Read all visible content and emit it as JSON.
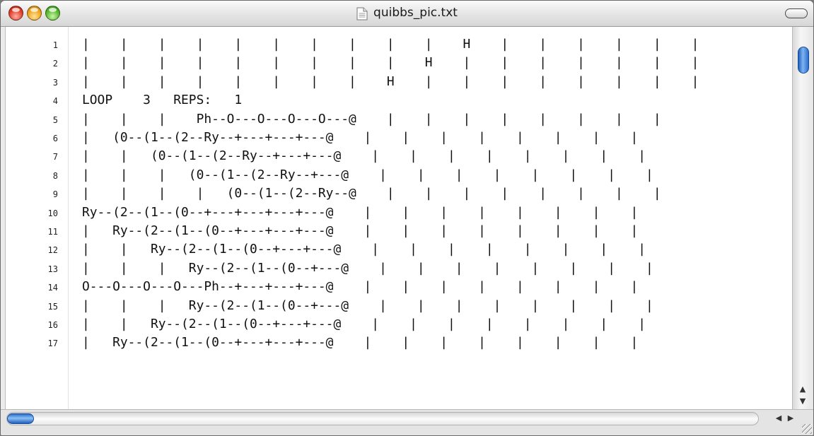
{
  "window": {
    "title": "quibbs_pic.txt",
    "file_icon": "text-document-icon"
  },
  "editor": {
    "lines": [
      {
        "num": "1",
        "text": "|    |    |    |    |    |    |    |    |    |    H    |    |    |    |    |    |"
      },
      {
        "num": "2",
        "text": "|    |    |    |    |    |    |    |    |    H    |    |    |    |    |    |    |"
      },
      {
        "num": "3",
        "text": "|    |    |    |    |    |    |    |    H    |    |    |    |    |    |    |    |"
      },
      {
        "num": "4",
        "text": "LOOP    3   REPS:   1"
      },
      {
        "num": "5",
        "text": "|    |    |    Ph--O---O---O---O---@    |    |    |    |    |    |    |    |"
      },
      {
        "num": "6",
        "text": "|   (0--(1--(2--Ry--+---+---+---@    |    |    |    |    |    |    |    |"
      },
      {
        "num": "7",
        "text": "|    |   (0--(1--(2--Ry--+---+---@    |    |    |    |    |    |    |    |"
      },
      {
        "num": "8",
        "text": "|    |    |   (0--(1--(2--Ry--+---@    |    |    |    |    |    |    |    |"
      },
      {
        "num": "9",
        "text": "|    |    |    |   (0--(1--(2--Ry--@    |    |    |    |    |    |    |    |"
      },
      {
        "num": "10",
        "text": "Ry--(2--(1--(0--+---+---+---+---@    |    |    |    |    |    |    |    |"
      },
      {
        "num": "11",
        "text": "|   Ry--(2--(1--(0--+---+---+---@    |    |    |    |    |    |    |    |"
      },
      {
        "num": "12",
        "text": "|    |   Ry--(2--(1--(0--+---+---@    |    |    |    |    |    |    |    |"
      },
      {
        "num": "13",
        "text": "|    |    |   Ry--(2--(1--(0--+---@    |    |    |    |    |    |    |    |"
      },
      {
        "num": "14",
        "text": "O---O---O---O---Ph--+---+---+---@    |    |    |    |    |    |    |    |"
      },
      {
        "num": "15",
        "text": "|    |    |   Ry--(2--(1--(0--+---@    |    |    |    |    |    |    |    |"
      },
      {
        "num": "16",
        "text": "|    |   Ry--(2--(1--(0--+---+---@    |    |    |    |    |    |    |    |"
      },
      {
        "num": "17",
        "text": "|   Ry--(2--(1--(0--+---+---+---@    |    |    |    |    |    |    |    |"
      }
    ]
  },
  "scrollbars": {
    "vertical": {
      "position": 0.0,
      "up_arrow": "▲",
      "down_arrow": "▼"
    },
    "horizontal": {
      "position": 0.0,
      "left_arrow": "◀",
      "right_arrow": "▶"
    }
  },
  "colors": {
    "close": "#e0402c",
    "minimize": "#f0a51c",
    "zoom": "#57b82d",
    "scroll_thumb": "#2a6fd0"
  }
}
